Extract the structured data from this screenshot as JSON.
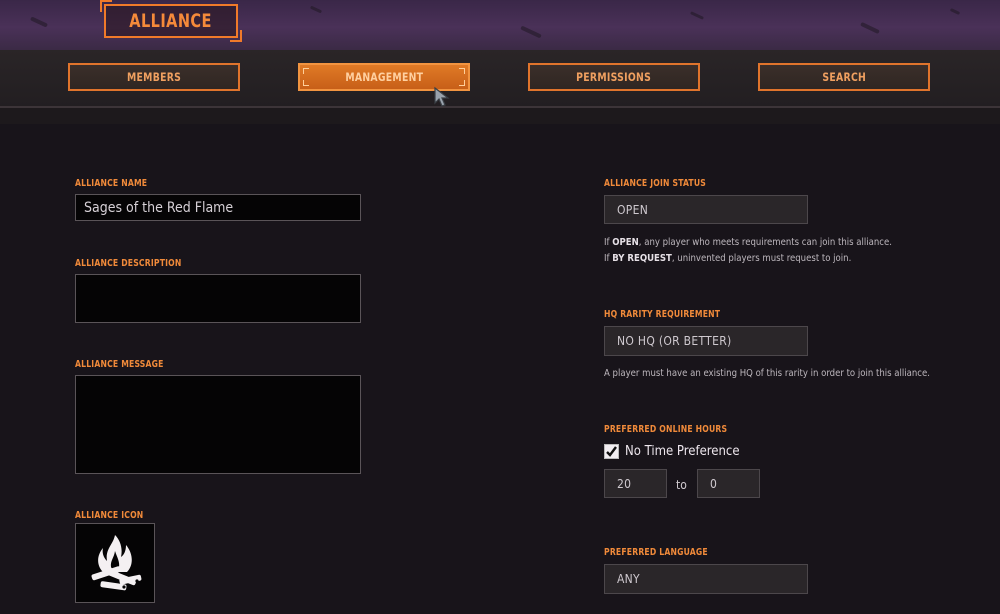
{
  "header": {
    "title": "ALLIANCE"
  },
  "tabs": [
    {
      "label": "MEMBERS",
      "active": false
    },
    {
      "label": "MANAGEMENT",
      "active": true
    },
    {
      "label": "PERMISSIONS",
      "active": false
    },
    {
      "label": "SEARCH",
      "active": false
    }
  ],
  "left": {
    "name_label": "ALLIANCE NAME",
    "name_value": "Sages of the Red Flame",
    "description_label": "ALLIANCE DESCRIPTION",
    "description_value": "",
    "message_label": "ALLIANCE MESSAGE",
    "message_value": "",
    "icon_label": "ALLIANCE ICON",
    "icon_name": "campfire-icon"
  },
  "right": {
    "join_status_label": "ALLIANCE JOIN STATUS",
    "join_status_value": "OPEN",
    "join_note_1_pre": "If ",
    "join_note_1_bold": "OPEN",
    "join_note_1_post": ", any player who meets requirements can join this alliance.",
    "join_note_2_pre": "If ",
    "join_note_2_bold": "BY REQUEST",
    "join_note_2_post": ", uninvented players must request to join.",
    "hq_label": "HQ RARITY REQUIREMENT",
    "hq_value": "NO HQ (OR BETTER)",
    "hq_note": "A player must have an existing HQ of this rarity in order to join this alliance.",
    "hours_label": "PREFERRED ONLINE HOURS",
    "no_time_label": "No Time Preference",
    "no_time_checked": true,
    "hours_from": "20",
    "hours_to_word": "to",
    "hours_to": "0",
    "language_label": "PREFERRED LANGUAGE",
    "language_value": "ANY"
  },
  "colors": {
    "accent": "#f08a3a",
    "tab_active": "#e07a26",
    "banner": "#4a3158",
    "background": "#18141a"
  }
}
